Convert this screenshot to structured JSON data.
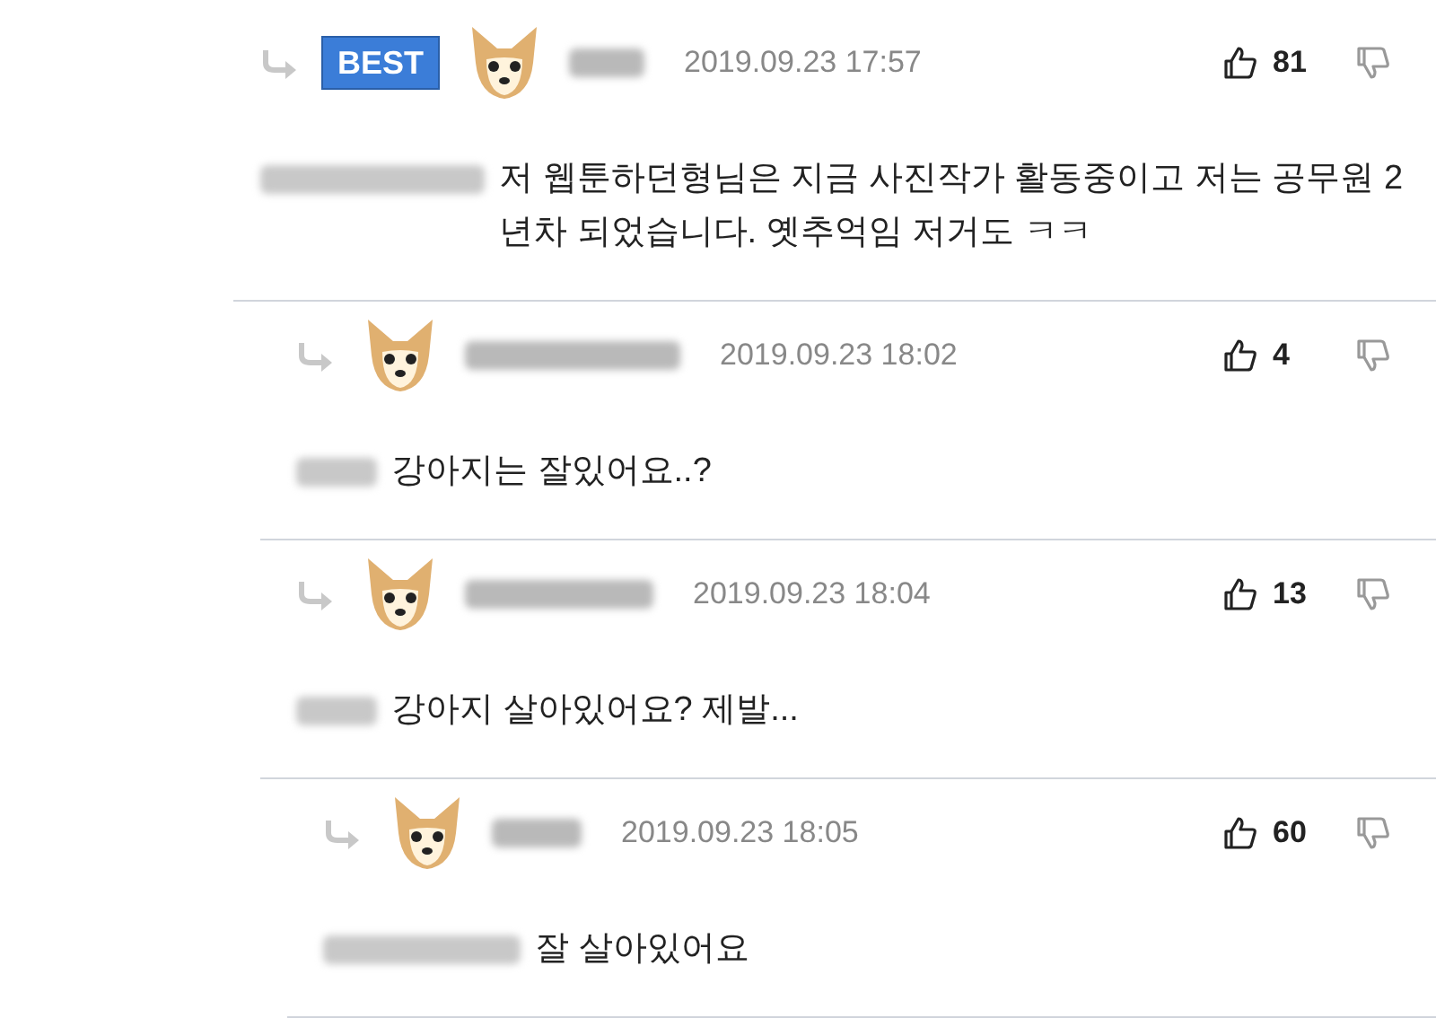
{
  "comments": [
    {
      "badge": "BEST",
      "date": "2019.09.23 17:57",
      "likes": "81",
      "text": "저 웹툰하던형님은 지금 사진작가 활동중이고 저는 공무원 2년차 되었습니다. 옛추억임 저거도 ㅋㅋ",
      "children": [
        {
          "date": "2019.09.23 18:02",
          "likes": "4",
          "text": "강아지는 잘있어요..?"
        },
        {
          "date": "2019.09.23 18:04",
          "likes": "13",
          "text": "강아지 살아있어요? 제발...",
          "children": [
            {
              "date": "2019.09.23 18:05",
              "likes": "60",
              "text": "잘 살아있어요"
            }
          ]
        }
      ]
    }
  ]
}
